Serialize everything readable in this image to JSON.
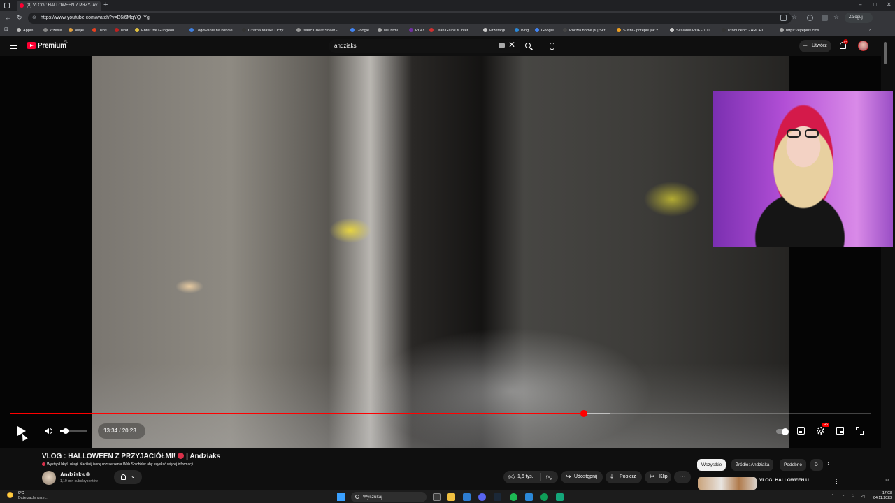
{
  "browser": {
    "tab_title": "(8) VLOG : HALLOWEEN Z PRZYJA",
    "new_tab": "+",
    "url": "https://www.youtube.com/watch?v=B6i6MqYQ_Yg",
    "profile_label": "Zaloguj",
    "window_controls": [
      "–",
      "□",
      "✕"
    ]
  },
  "bookmarks": [
    {
      "label": "Apple",
      "color": "#bbbbbb"
    },
    {
      "label": "krzesla",
      "color": "#888888"
    },
    {
      "label": "olejki",
      "color": "#e0a040"
    },
    {
      "label": "usos",
      "color": "#e84020"
    },
    {
      "label": "isod",
      "color": "#c02020"
    },
    {
      "label": "Enter the Gungeon...",
      "color": "#e0c040"
    },
    {
      "label": "Logowanie na koncie",
      "color": "#4080e0"
    },
    {
      "label": "Czarna Maska Oczy...",
      "color": "#333333"
    },
    {
      "label": "Isaac Cheat Sheet -...",
      "color": "#999999"
    },
    {
      "label": "Google",
      "color": "#4285f4"
    },
    {
      "label": "will.html",
      "color": "#aaaaaa"
    },
    {
      "label": "PLAY",
      "color": "#7030a0"
    },
    {
      "label": "Lean Gains & Inter...",
      "color": "#d03030"
    },
    {
      "label": "Przetargi",
      "color": "#cccccc"
    },
    {
      "label": "Bing",
      "color": "#2b88d8"
    },
    {
      "label": "Google",
      "color": "#4285f4"
    },
    {
      "label": "Poczta home.pl | Skr...",
      "color": "#444444"
    },
    {
      "label": "Sushi - przepis jak z...",
      "color": "#f0a020"
    },
    {
      "label": "Scalanie PDF - 100...",
      "color": "#cccccc"
    },
    {
      "label": "Producenci - ARCHI...",
      "color": "#333333"
    },
    {
      "label": "https://eyeplus.clos...",
      "color": "#aaaaaa"
    }
  ],
  "youtube": {
    "brand": "Premium",
    "country": "PL",
    "search_value": "andziaks",
    "create_label": "Utwórz",
    "notification_count": "9+"
  },
  "player": {
    "current_time": "13:34",
    "duration": "20:23",
    "time_display": "13:34 / 20:23",
    "played_fraction": 0.666,
    "buffered_fraction": 0.697,
    "volume_fraction": 0.2,
    "hd_badge": "HD"
  },
  "video": {
    "title_part1": "VLOG : HALLOWEEN Z PRZYJACIÓŁMI!",
    "title_part2": "| Andziaks",
    "scrobbler_notice": "Wystąpił błąd usługi. Naciśnij ikonę rozszerzenia Web Scrobbler aby uzyskać więcej informacji.",
    "channel_name": "Andziaks",
    "subscribers": "1,19 mln subskrybentów"
  },
  "actions": {
    "likes": "1,6 tys.",
    "share": "Udostępnij",
    "download": "Pobierz",
    "clip": "Klip",
    "more": "⋯"
  },
  "chips": [
    {
      "label": "Wszystkie",
      "active": true
    },
    {
      "label": "Źródło: Andziaka",
      "active": false
    },
    {
      "label": "Podobne",
      "active": false
    },
    {
      "label": "D",
      "active": false
    }
  ],
  "recommendation": {
    "title": "VLOG: HALLOWEEN U"
  },
  "taskbar": {
    "temperature": "9°C",
    "weather_desc": "Duże zachmurze...",
    "search_placeholder": "Wyszukaj",
    "time": "17:03",
    "date": "04.11.2023"
  },
  "colors": {
    "youtube_red": "#ff0033",
    "progress_red": "#ff0000",
    "background": "#0f0f0f"
  }
}
